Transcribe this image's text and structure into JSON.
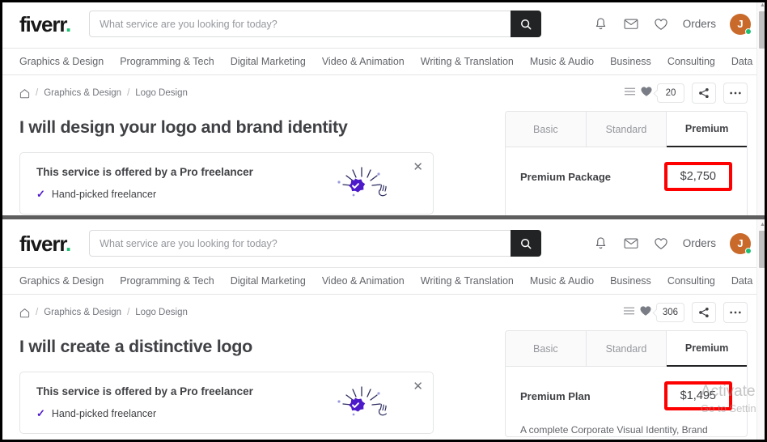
{
  "header": {
    "logo_text": "fiverr",
    "logo_dot": ".",
    "search_placeholder": "What service are you looking for today?",
    "search_value": "",
    "search_icon": "search-icon",
    "notifications_icon": "bell-icon",
    "messages_icon": "envelope-icon",
    "favorites_icon": "heart-outline-icon",
    "orders_label": "Orders",
    "avatar_initial": "J",
    "avatar_color": "#c96a2b",
    "status_dot_color": "#1dbf73"
  },
  "categories": [
    "Graphics & Design",
    "Programming & Tech",
    "Digital Marketing",
    "Video & Animation",
    "Writing & Translation",
    "Music & Audio",
    "Business",
    "Consulting",
    "Data"
  ],
  "category_more": "›",
  "panel_top": {
    "breadcrumb": {
      "home_icon": "home-icon",
      "separator": "/",
      "items": [
        "Graphics & Design",
        "Logo Design"
      ]
    },
    "actions": {
      "list_icon": "list-icon",
      "heart_icon": "heart-filled-icon",
      "favorite_count": "20",
      "share_icon": "share-icon",
      "more_icon": "ellipsis-icon"
    },
    "gig_title": "I will design your logo and brand identity",
    "pro_box": {
      "title": "This service is offered by a Pro freelancer",
      "bullet": "Hand-picked freelancer",
      "check_glyph": "✓",
      "close_glyph": "✕",
      "badge_icon": "pro-verified-badge-icon"
    },
    "pricing": {
      "tabs": [
        "Basic",
        "Standard",
        "Premium"
      ],
      "active_tab": "Premium",
      "package_name": "Premium Package",
      "price": "$2,750",
      "highlight_color": "#ff0000",
      "description": ""
    }
  },
  "panel_bottom": {
    "breadcrumb": {
      "home_icon": "home-icon",
      "separator": "/",
      "items": [
        "Graphics & Design",
        "Logo Design"
      ]
    },
    "actions": {
      "list_icon": "list-icon",
      "heart_icon": "heart-filled-icon",
      "favorite_count": "306",
      "share_icon": "share-icon",
      "more_icon": "ellipsis-icon"
    },
    "gig_title": "I will create a distinctive logo",
    "pro_box": {
      "title": "This service is offered by a Pro freelancer",
      "bullet": "Hand-picked freelancer",
      "check_glyph": "✓",
      "close_glyph": "✕",
      "badge_icon": "pro-verified-badge-icon"
    },
    "pricing": {
      "tabs": [
        "Basic",
        "Standard",
        "Premium"
      ],
      "active_tab": "Premium",
      "package_name": "Premium Plan",
      "price": "$1,495",
      "highlight_color": "#ff0000",
      "description": "A complete Corporate Visual Identity, Brand"
    }
  },
  "watermark": {
    "line1": "Activate",
    "line2": "Go to Settin"
  }
}
